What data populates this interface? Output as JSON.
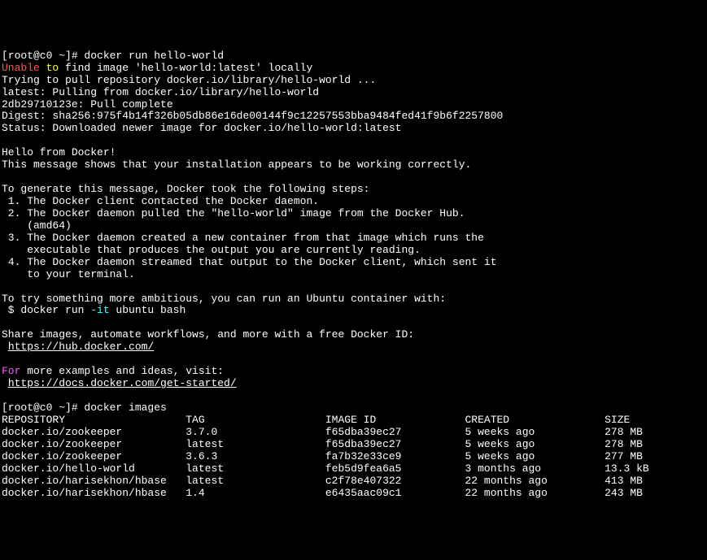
{
  "prompt1": "[root@c0 ~]# ",
  "cmd1": "docker run hello-world",
  "pull": {
    "unable": "Unable",
    "to": " to",
    "rest_line": " find image 'hello-world:latest' locally",
    "l2": "Trying to pull repository docker.io/library/hello-world ...",
    "l3": "latest: Pulling from docker.io/library/hello-world",
    "l4": "2db29710123e: Pull complete",
    "l5": "Digest: sha256:975f4b14f326b05db86e16de00144f9c12257553bba9484fed41f9b6f2257800",
    "l6": "Status: Downloaded newer image for docker.io/hello-world:latest"
  },
  "hello": {
    "l1": "Hello from Docker!",
    "l2": "This message shows that your installation appears to be working correctly.",
    "l3": "To generate this message, Docker took the following steps:",
    "l4": " 1. The Docker client contacted the Docker daemon.",
    "l5": " 2. The Docker daemon pulled the \"hello-world\" image from the Docker Hub.",
    "l6": "    (amd64)",
    "l7": " 3. The Docker daemon created a new container from that image which runs the",
    "l8": "    executable that produces the output you are currently reading.",
    "l9": " 4. The Docker daemon streamed that output to the Docker client, which sent it",
    "l10": "    to your terminal.",
    "l11": "To try something more ambitious, you can run an Ubuntu container with:",
    "l12a": " $ docker run ",
    "l12flag": "-it",
    "l12b": " ubuntu bash",
    "l13": "Share images, automate workflows, and more with a free Docker ID:",
    "l14": "https://hub.docker.com/",
    "l15a": "For",
    "l15b": " more examples and ideas, visit:",
    "l16": "https://docs.docker.com/get-started/"
  },
  "prompt2": "[root@c0 ~]# ",
  "cmd2": "docker images",
  "table": {
    "headers": {
      "repo": "REPOSITORY",
      "tag": "TAG",
      "image_id": "IMAGE ID",
      "created": "CREATED",
      "size": "SIZE"
    },
    "rows": [
      {
        "repo": "docker.io/zookeeper",
        "tag": "3.7.0",
        "image_id": "f65dba39ec27",
        "created": "5 weeks ago",
        "size": "278 MB"
      },
      {
        "repo": "docker.io/zookeeper",
        "tag": "latest",
        "image_id": "f65dba39ec27",
        "created": "5 weeks ago",
        "size": "278 MB"
      },
      {
        "repo": "docker.io/zookeeper",
        "tag": "3.6.3",
        "image_id": "fa7b32e33ce9",
        "created": "5 weeks ago",
        "size": "277 MB"
      },
      {
        "repo": "docker.io/hello-world",
        "tag": "latest",
        "image_id": "feb5d9fea6a5",
        "created": "3 months ago",
        "size": "13.3 kB"
      },
      {
        "repo": "docker.io/harisekhon/hbase",
        "tag": "latest",
        "image_id": "c2f78e407322",
        "created": "22 months ago",
        "size": "413 MB"
      },
      {
        "repo": "docker.io/harisekhon/hbase",
        "tag": "1.4",
        "image_id": "e6435aac09c1",
        "created": "22 months ago",
        "size": "243 MB"
      }
    ]
  }
}
